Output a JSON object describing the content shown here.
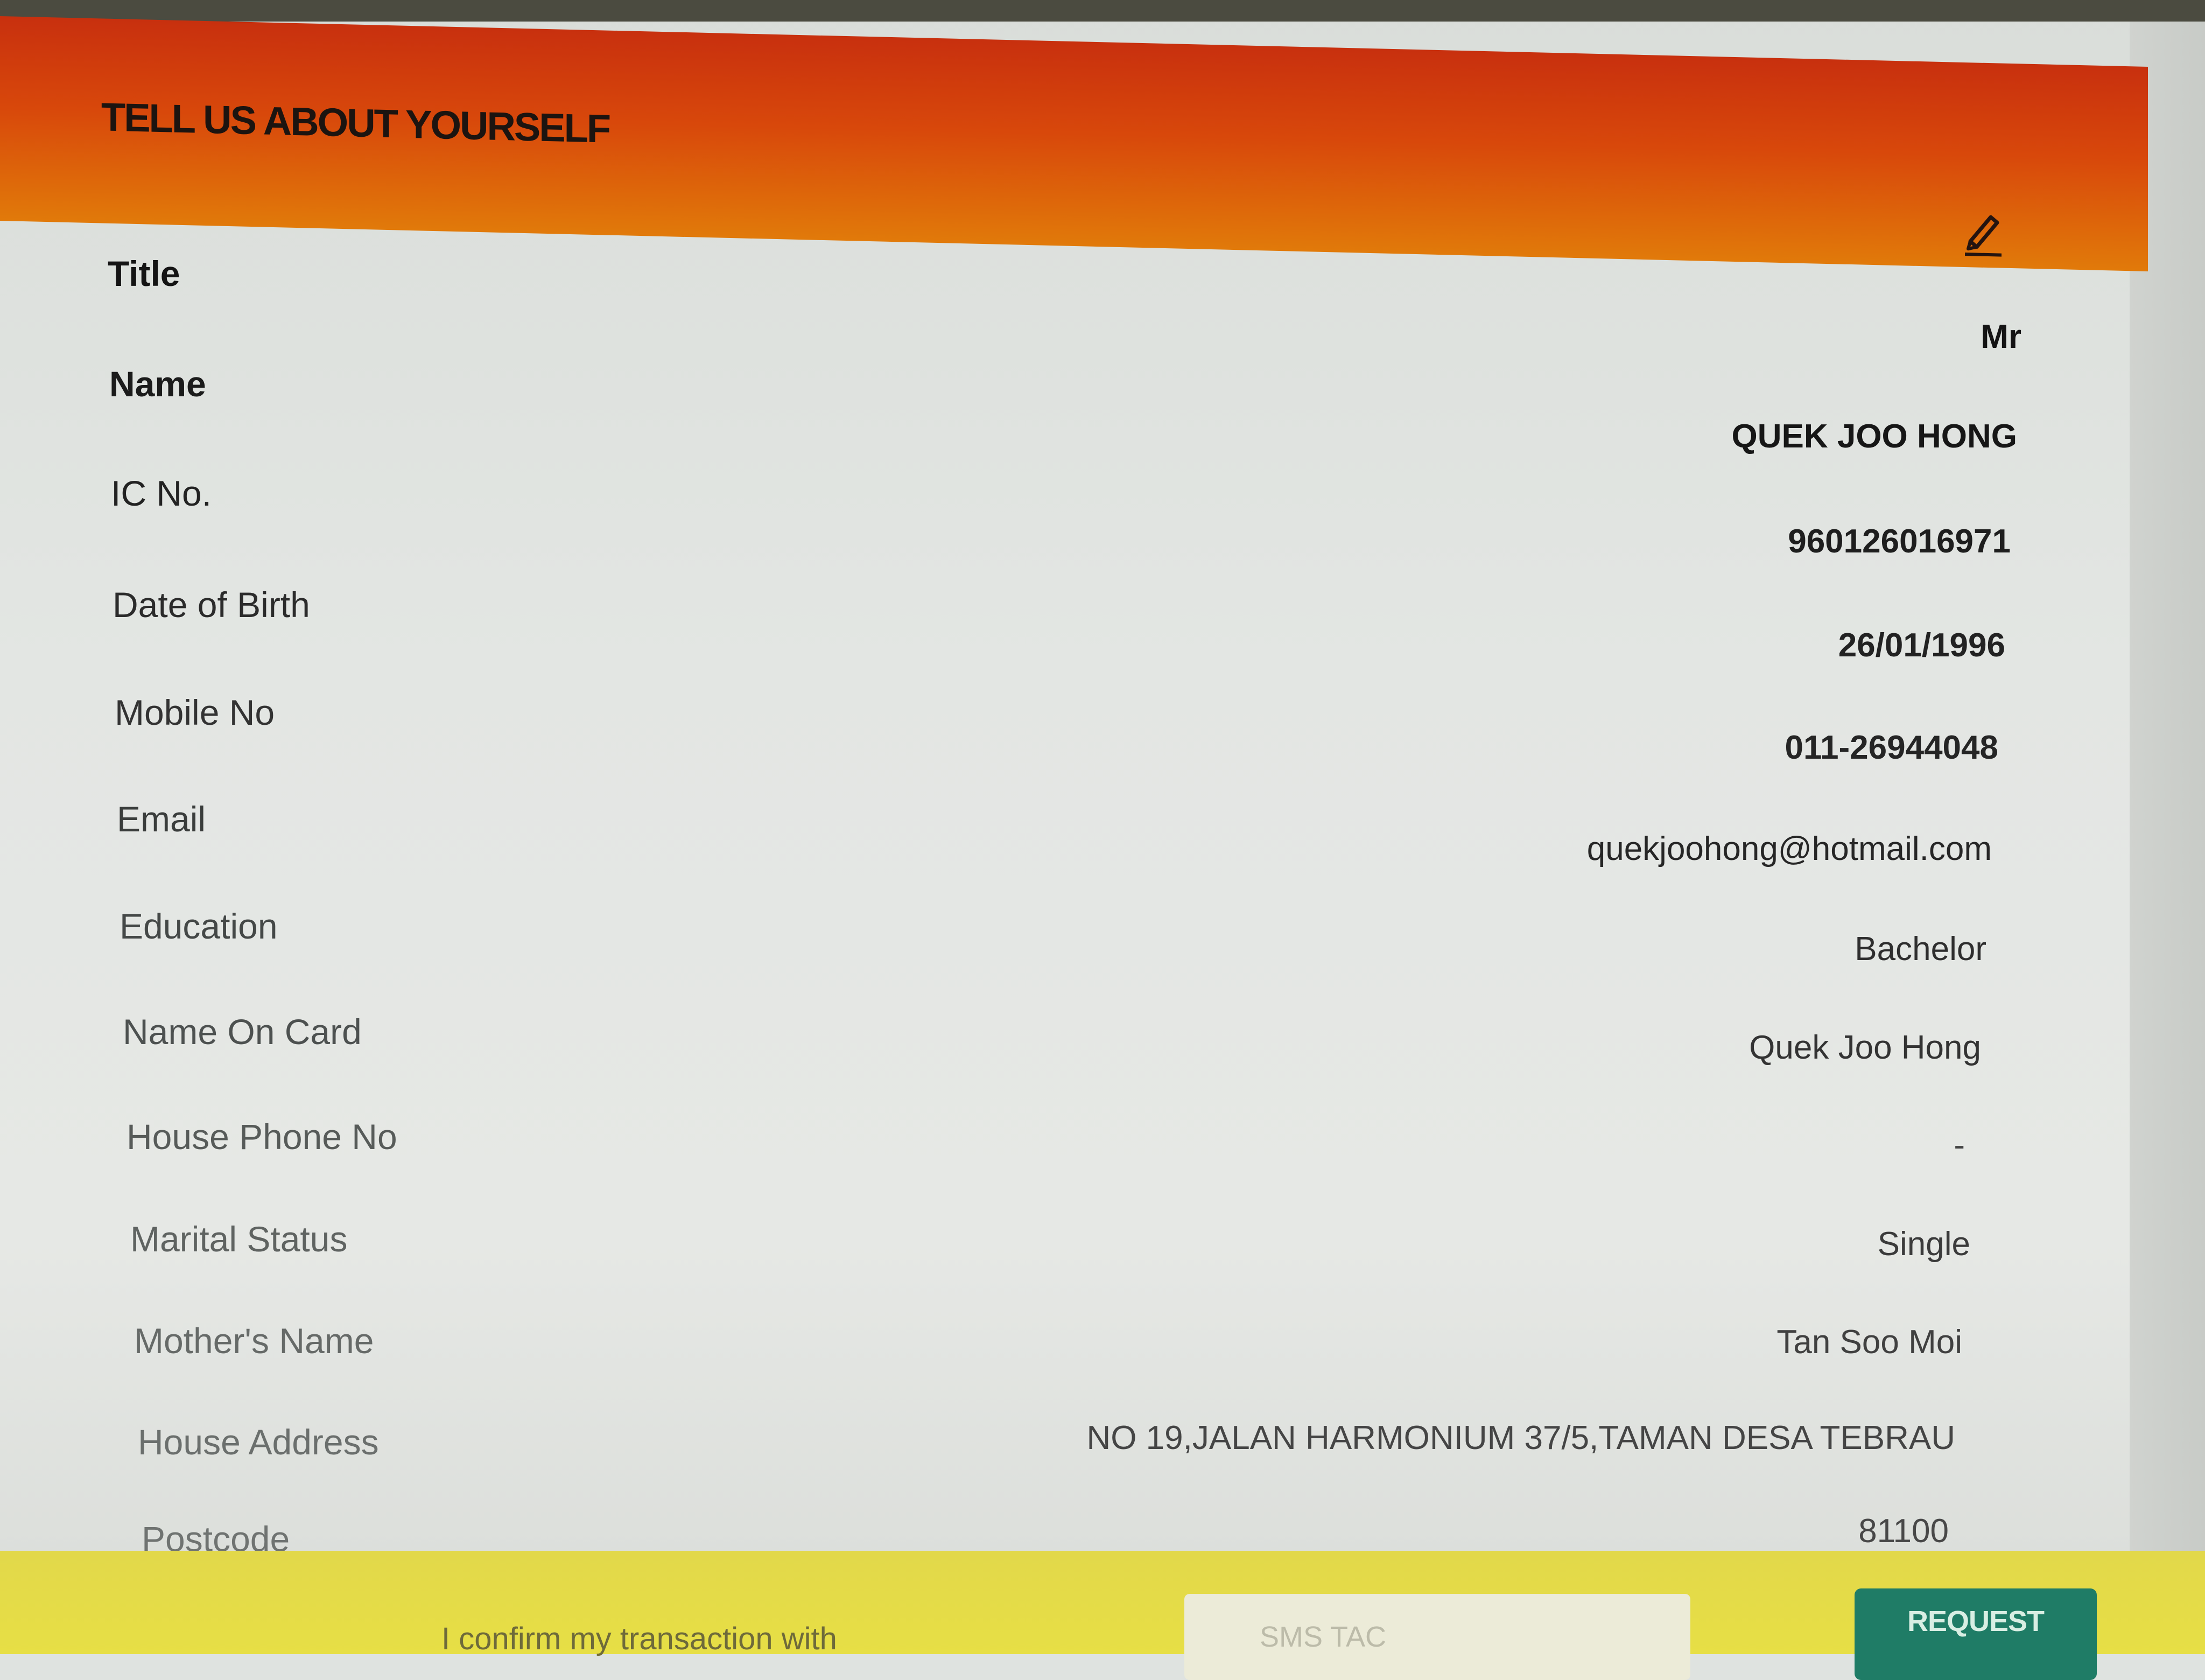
{
  "header": {
    "title": "TELL US ABOUT YOURSELF",
    "edit_icon": "pencil-edit-icon",
    "accent_colors": [
      "#c8300e",
      "#e17a0a"
    ]
  },
  "fields": [
    {
      "label": "Title",
      "value": "Mr"
    },
    {
      "label": "Name",
      "value": "QUEK JOO HONG"
    },
    {
      "label": "IC No.",
      "value": "960126016971"
    },
    {
      "label": "Date of Birth",
      "value": "26/01/1996"
    },
    {
      "label": "Mobile No",
      "value": "011-26944048"
    },
    {
      "label": "Email",
      "value": "quekjoohong@hotmail.com"
    },
    {
      "label": "Education",
      "value": "Bachelor"
    },
    {
      "label": "Name On Card",
      "value": "Quek Joo Hong"
    },
    {
      "label": "House Phone No",
      "value": "-"
    },
    {
      "label": "Marital Status",
      "value": "Single"
    },
    {
      "label": "Mother's Name",
      "value": "Tan Soo Moi"
    },
    {
      "label": "House Address",
      "value": "NO 19,JALAN HARMONIUM 37/5,TAMAN DESA TEBRAU"
    },
    {
      "label": "Postcode",
      "value": "81100"
    }
  ],
  "footer": {
    "confirm_text": "I confirm my transaction with",
    "sms_placeholder": "SMS TAC",
    "request_label": "REQUEST",
    "button_color": "#1f7c66",
    "background_color": "#e5dc46"
  }
}
